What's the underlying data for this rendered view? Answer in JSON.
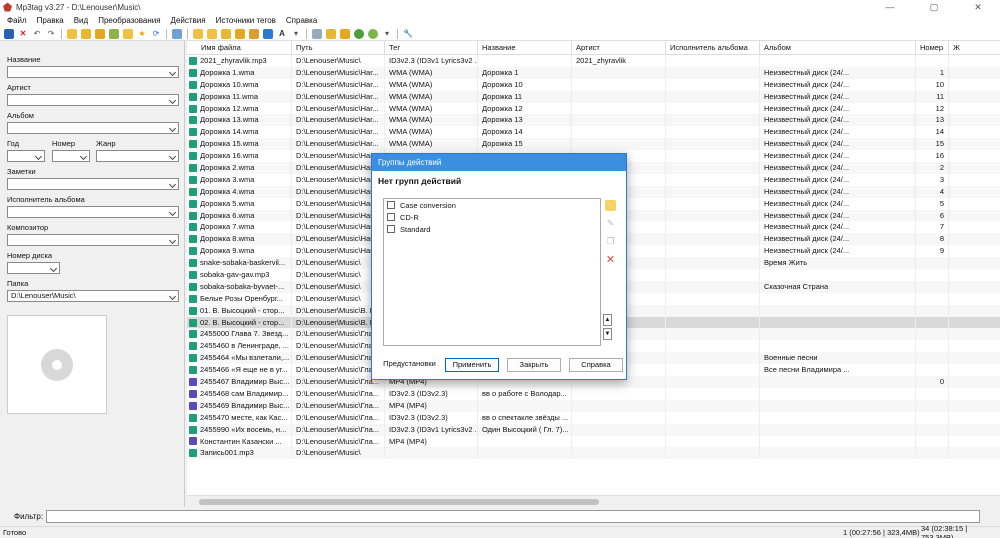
{
  "window": {
    "title": "Mp3tag v3.27 - D:\\Lenouser\\Music\\",
    "min": "—",
    "max": "▢",
    "close": "✕"
  },
  "menu": [
    "Файл",
    "Правка",
    "Вид",
    "Преобразования",
    "Действия",
    "Источники тегов",
    "Справка"
  ],
  "left_panel": {
    "title_label": "Название",
    "artist_label": "Артист",
    "album_label": "Альбом",
    "year_label": "Год",
    "number_label": "Номер",
    "genre_label": "Жанр",
    "comment_label": "Заметки",
    "album_artist_label": "Исполнитель альбома",
    "composer_label": "Композитор",
    "disc_label": "Номер диска",
    "folder_label": "Папка",
    "folder_value": "D:\\Lenouser\\Music\\"
  },
  "columns": [
    "Имя файла",
    "Путь",
    "Тег",
    "Название",
    "Артист",
    "Исполнитель альбома",
    "Альбом",
    "Номер",
    "Ж"
  ],
  "rows": [
    {
      "type": "mp3",
      "file": "2021_zhyravlik.mp3",
      "path": "D:\\Lenouser\\Music\\",
      "tag": "ID3v2.3 (ID3v1 Lyrics3v2 ...",
      "title": "",
      "artist": "2021_zhyravlik",
      "aartist": "",
      "album": "",
      "num": ""
    },
    {
      "type": "wma",
      "file": "Дорожка 1.wma",
      "path": "D:\\Lenouser\\Music\\Har...",
      "tag": "WMA (WMA)",
      "title": "Дорожка 1",
      "artist": "",
      "aartist": "",
      "album": "Неизвестный диск (24/...",
      "num": "1"
    },
    {
      "type": "wma",
      "file": "Дорожка 10.wma",
      "path": "D:\\Lenouser\\Music\\Har...",
      "tag": "WMA (WMA)",
      "title": "Дорожка 10",
      "artist": "",
      "aartist": "",
      "album": "Неизвестный диск (24/...",
      "num": "10"
    },
    {
      "type": "wma",
      "file": "Дорожка 11.wma",
      "path": "D:\\Lenouser\\Music\\Har...",
      "tag": "WMA (WMA)",
      "title": "Дорожка 11",
      "artist": "",
      "aartist": "",
      "album": "Неизвестный диск (24/...",
      "num": "11"
    },
    {
      "type": "wma",
      "file": "Дорожка 12.wma",
      "path": "D:\\Lenouser\\Music\\Har...",
      "tag": "WMA (WMA)",
      "title": "Дорожка 12",
      "artist": "",
      "aartist": "",
      "album": "Неизвестный диск (24/...",
      "num": "12"
    },
    {
      "type": "wma",
      "file": "Дорожка 13.wma",
      "path": "D:\\Lenouser\\Music\\Har...",
      "tag": "WMA (WMA)",
      "title": "Дорожка 13",
      "artist": "",
      "aartist": "",
      "album": "Неизвестный диск (24/...",
      "num": "13"
    },
    {
      "type": "wma",
      "file": "Дорожка 14.wma",
      "path": "D:\\Lenouser\\Music\\Har...",
      "tag": "WMA (WMA)",
      "title": "Дорожка 14",
      "artist": "",
      "aartist": "",
      "album": "Неизвестный диск (24/...",
      "num": "14"
    },
    {
      "type": "wma",
      "file": "Дорожка 15.wma",
      "path": "D:\\Lenouser\\Music\\Har...",
      "tag": "WMA (WMA)",
      "title": "Дорожка 15",
      "artist": "",
      "aartist": "",
      "album": "Неизвестный диск (24/...",
      "num": "15"
    },
    {
      "type": "wma",
      "file": "Дорожка 16.wma",
      "path": "D:\\Lenouser\\Music\\Har...",
      "tag": "",
      "title": "",
      "artist": "",
      "aartist": "",
      "album": "Неизвестный диск (24/...",
      "num": "16"
    },
    {
      "type": "wma",
      "file": "Дорожка 2.wma",
      "path": "D:\\Lenouser\\Music\\Har...",
      "tag": "",
      "title": "",
      "artist": "",
      "aartist": "",
      "album": "Неизвестный диск (24/...",
      "num": "2"
    },
    {
      "type": "wma",
      "file": "Дорожка 3.wma",
      "path": "D:\\Lenouser\\Music\\Har...",
      "tag": "",
      "title": "",
      "artist": "",
      "aartist": "",
      "album": "Неизвестный диск (24/...",
      "num": "3"
    },
    {
      "type": "wma",
      "file": "Дорожка 4.wma",
      "path": "D:\\Lenouser\\Music\\Har...",
      "tag": "",
      "title": "",
      "artist": "",
      "aartist": "",
      "album": "Неизвестный диск (24/...",
      "num": "4"
    },
    {
      "type": "wma",
      "file": "Дорожка 5.wma",
      "path": "D:\\Lenouser\\Music\\Har...",
      "tag": "",
      "title": "",
      "artist": "",
      "aartist": "",
      "album": "Неизвестный диск (24/...",
      "num": "5"
    },
    {
      "type": "wma",
      "file": "Дорожка 6.wma",
      "path": "D:\\Lenouser\\Music\\Har...",
      "tag": "",
      "title": "",
      "artist": "",
      "aartist": "",
      "album": "Неизвестный диск (24/...",
      "num": "6"
    },
    {
      "type": "wma",
      "file": "Дорожка 7.wma",
      "path": "D:\\Lenouser\\Music\\Har...",
      "tag": "",
      "title": "",
      "artist": "",
      "aartist": "",
      "album": "Неизвестный диск (24/...",
      "num": "7"
    },
    {
      "type": "wma",
      "file": "Дорожка 8.wma",
      "path": "D:\\Lenouser\\Music\\Har...",
      "tag": "",
      "title": "",
      "artist": "",
      "aartist": "",
      "album": "Неизвестный диск (24/...",
      "num": "8"
    },
    {
      "type": "wma",
      "file": "Дорожка 9.wma",
      "path": "D:\\Lenouser\\Music\\Har...",
      "tag": "",
      "title": "",
      "artist": "",
      "aartist": "",
      "album": "Неизвестный диск (24/...",
      "num": "9"
    },
    {
      "type": "mp3",
      "file": "snake-sobaka-baskervil...",
      "path": "D:\\Lenouser\\Music\\",
      "tag": "",
      "title": "",
      "artist": "",
      "aartist": "",
      "album": "Время Жить",
      "num": ""
    },
    {
      "type": "mp3",
      "file": "sobaka-gav-gav.mp3",
      "path": "D:\\Lenouser\\Music\\",
      "tag": "",
      "title": "",
      "artist": "",
      "aartist": "",
      "album": "",
      "num": ""
    },
    {
      "type": "mp3",
      "file": "sobaka-sobaka-byvaet-...",
      "path": "D:\\Lenouser\\Music\\",
      "tag": "",
      "title": "",
      "artist": "",
      "aartist": "",
      "album": "Сказочная Страна",
      "num": ""
    },
    {
      "type": "mp3",
      "file": "Белые Розы Оренбург...",
      "path": "D:\\Lenouser\\Music\\",
      "tag": "",
      "title": "",
      "artist": "",
      "aartist": "",
      "album": "",
      "num": ""
    },
    {
      "type": "mp3",
      "file": "01. В. Высоцкий - стор...",
      "path": "D:\\Lenouser\\Music\\В. В...",
      "tag": "",
      "title": "",
      "artist": "",
      "aartist": "",
      "album": "",
      "num": ""
    },
    {
      "type": "mp3",
      "file": "02. В. Высоцкий - стор...",
      "path": "D:\\Lenouser\\Music\\В. В...",
      "tag": "",
      "title": "",
      "artist": "",
      "aartist": "",
      "album": "",
      "num": "",
      "selected": true
    },
    {
      "type": "mp3",
      "file": "2455000 Глава 7. Звезд...",
      "path": "D:\\Lenouser\\Music\\Гла...",
      "tag": "",
      "title": "",
      "artist": "",
      "aartist": "",
      "album": "",
      "num": ""
    },
    {
      "type": "mp3",
      "file": "2455460 в Ленинграде, ...",
      "path": "D:\\Lenouser\\Music\\Гла...",
      "tag": "",
      "title": "",
      "artist": "",
      "aartist": "",
      "album": "",
      "num": ""
    },
    {
      "type": "mp3",
      "file": "2455464 «Мы взлетали,...",
      "path": "D:\\Lenouser\\Music\\Гла...",
      "tag": "",
      "title": "",
      "artist": "",
      "aartist": "",
      "album": "Военные песни",
      "num": ""
    },
    {
      "type": "mp3",
      "file": "2455466 «Я еще не в уг...",
      "path": "D:\\Lenouser\\Music\\Гла...",
      "tag": "",
      "title": "",
      "artist": "",
      "aartist": "",
      "album": "Все песни Владимира ...",
      "num": ""
    },
    {
      "type": "mp4",
      "file": "2455467 Владимир Выс...",
      "path": "D:\\Lenouser\\Music\\Гла...",
      "tag": "MP4 (MP4)",
      "title": "",
      "artist": "",
      "aartist": "",
      "album": "",
      "num": "0"
    },
    {
      "type": "mp4",
      "file": "2455468 сам Владимир...",
      "path": "D:\\Lenouser\\Music\\Гла...",
      "tag": "ID3v2.3 (ID3v2.3)",
      "title": "вв о работе с Володар...",
      "artist": "",
      "aartist": "",
      "album": "",
      "num": ""
    },
    {
      "type": "mp4",
      "file": "2455469 Владимир Выс...",
      "path": "D:\\Lenouser\\Music\\Гла...",
      "tag": "MP4 (MP4)",
      "title": "",
      "artist": "",
      "aartist": "",
      "album": "",
      "num": ""
    },
    {
      "type": "mp3",
      "file": "2455470 месте, как Кас...",
      "path": "D:\\Lenouser\\Music\\Гла...",
      "tag": "ID3v2.3 (ID3v2.3)",
      "title": "вв о спектакле звёзды ...",
      "artist": "",
      "aartist": "",
      "album": "",
      "num": ""
    },
    {
      "type": "mp3",
      "file": "2455990 «Их восемь, н...",
      "path": "D:\\Lenouser\\Music\\Гла...",
      "tag": "ID3v2.3 (ID3v1 Lyrics3v2 ...",
      "title": "Один Высоцкий ( Гл. 7)...",
      "artist": "",
      "aartist": "",
      "album": "",
      "num": ""
    },
    {
      "type": "mp4",
      "file": "Константин Казански ...",
      "path": "D:\\Lenouser\\Music\\Гла...",
      "tag": "MP4 (MP4)",
      "title": "",
      "artist": "",
      "aartist": "",
      "album": "",
      "num": ""
    },
    {
      "type": "mp3",
      "file": "Запись001.mp3",
      "path": "D:\\Lenouser\\Music\\",
      "tag": "",
      "title": "",
      "artist": "",
      "aartist": "",
      "album": "",
      "num": ""
    }
  ],
  "dialog": {
    "title": "Группы действий",
    "header": "Нет групп действий",
    "items": [
      "Case conversion",
      "CD-R",
      "Standard"
    ],
    "btn_presets": "Предустановки",
    "btn_apply": "Применить",
    "btn_close": "Закрыть",
    "btn_help": "Справка"
  },
  "filter": {
    "label": "Фильтр:",
    "value": ""
  },
  "status": {
    "left": "Готово",
    "selected": "1 (00:27:56 | 323,4MB)",
    "total": "34 (02:38:15 | 753,3MB)"
  },
  "colors": {
    "mp3": "#1f9e7a",
    "wma": "#1f9e7a",
    "mp4": "#5b4bb7",
    "accent": "#3a8fe0"
  }
}
